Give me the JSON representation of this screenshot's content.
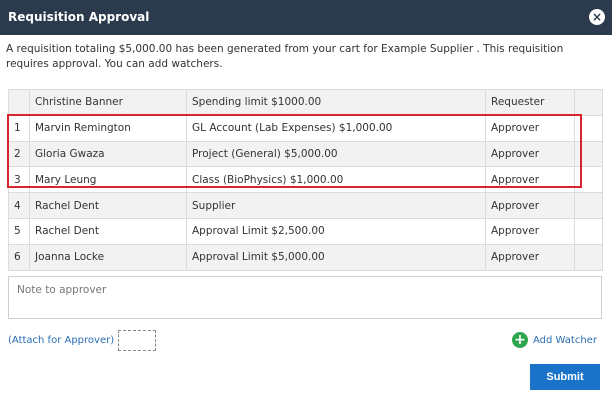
{
  "dialog": {
    "title": "Requisition Approval",
    "close_icon": "×",
    "intro": "A requisition totaling $5,000.00 has been generated from your cart for Example Supplier . This requisition requires approval. You can add watchers."
  },
  "table": {
    "rows": [
      {
        "num": "",
        "name": "Christine Banner",
        "rule": "Spending limit $1000.00",
        "role": "Requester"
      },
      {
        "num": "1",
        "name": "Marvin Remington",
        "rule": "GL Account (Lab Expenses) $1,000.00",
        "role": "Approver"
      },
      {
        "num": "2",
        "name": "Gloria Gwaza",
        "rule": "Project (General) $5,000.00",
        "role": "Approver"
      },
      {
        "num": "3",
        "name": "Mary Leung",
        "rule": "Class (BioPhysics) $1,000.00",
        "role": "Approver"
      },
      {
        "num": "4",
        "name": "Rachel Dent",
        "rule": "Supplier",
        "role": "Approver"
      },
      {
        "num": "5",
        "name": "Rachel Dent",
        "rule": "Approval Limit $2,500.00",
        "role": "Approver"
      },
      {
        "num": "6",
        "name": "Joanna Locke",
        "rule": "Approval Limit $5,000.00",
        "role": "Approver"
      }
    ]
  },
  "note": {
    "placeholder": "Note to approver"
  },
  "attach": {
    "label": "(Attach for Approver)"
  },
  "watcher": {
    "icon": "+",
    "label": "Add Watcher"
  },
  "submit": {
    "label": "Submit"
  },
  "colors": {
    "header": "#2b3a4c",
    "highlight": "#d9252f",
    "submit": "#1a73c9",
    "add_icon": "#2ea44f",
    "link": "#2a6db5"
  }
}
